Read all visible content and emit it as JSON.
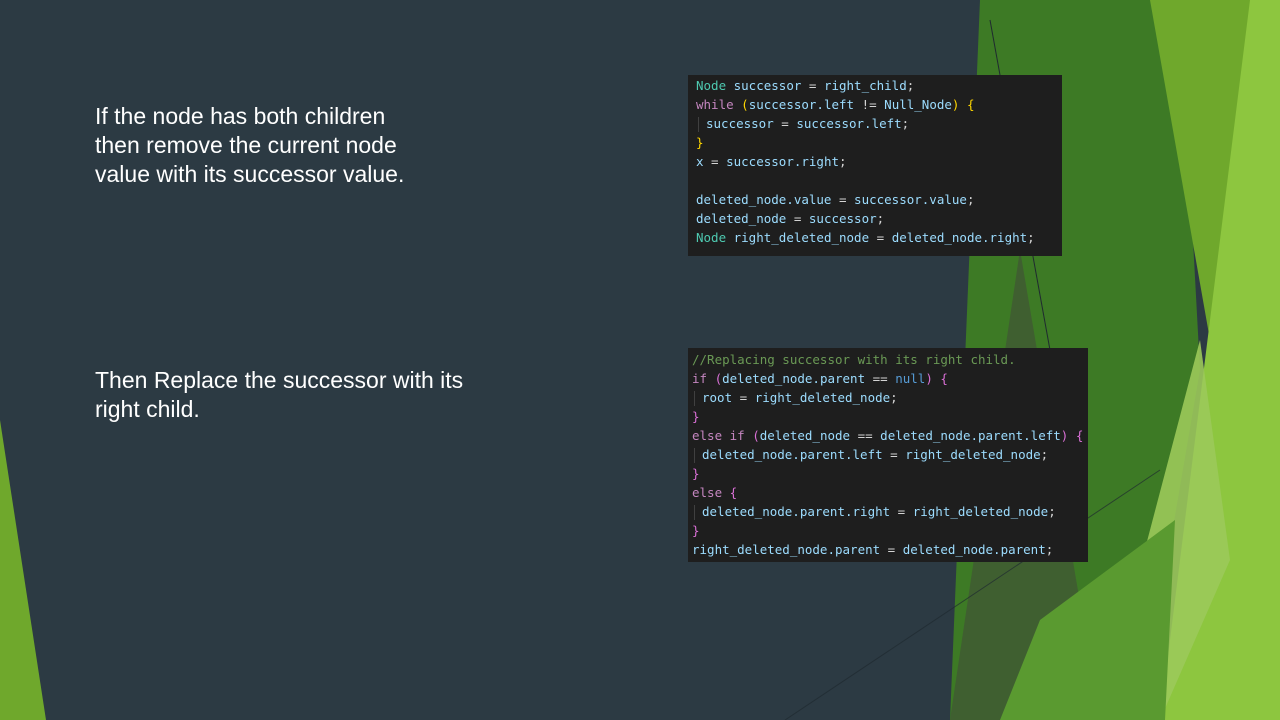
{
  "slide": {
    "colors": {
      "background": "#2c3a43",
      "accent_green_light": "#8dc63f",
      "accent_green_mid": "#6fa82c",
      "accent_green_dark": "#3d7a25"
    },
    "text_blocks": [
      {
        "lines": [
          "If the node has both children",
          "then remove the current node",
          "value with its successor value."
        ]
      },
      {
        "lines": [
          "Then Replace the successor with its",
          "right child."
        ]
      }
    ]
  },
  "code_panels": [
    {
      "lines": [
        [
          [
            "type",
            "Node"
          ],
          [
            "var",
            " successor"
          ],
          [
            "op",
            " = "
          ],
          [
            "var",
            "right_child"
          ],
          [
            "op",
            ";"
          ]
        ],
        [
          [
            "kw",
            "while"
          ],
          [
            "op",
            " "
          ],
          [
            "bracket",
            "("
          ],
          [
            "var",
            "successor.left"
          ],
          [
            "op",
            " != "
          ],
          [
            "var",
            "Null_Node"
          ],
          [
            "bracket",
            ")"
          ],
          [
            "op",
            " "
          ],
          [
            "bracket",
            "{"
          ]
        ],
        [
          [
            "guide",
            ""
          ],
          [
            "var",
            "successor"
          ],
          [
            "op",
            " = "
          ],
          [
            "var",
            "successor.left"
          ],
          [
            "op",
            ";"
          ]
        ],
        [
          [
            "bracket",
            "}"
          ]
        ],
        [
          [
            "var",
            "x"
          ],
          [
            "op",
            " = "
          ],
          [
            "var",
            "successor.right"
          ],
          [
            "op",
            ";"
          ]
        ],
        [],
        [
          [
            "var",
            "deleted_node.value"
          ],
          [
            "op",
            " = "
          ],
          [
            "var",
            "successor.value"
          ],
          [
            "op",
            ";"
          ]
        ],
        [
          [
            "var",
            "deleted_node"
          ],
          [
            "op",
            " = "
          ],
          [
            "var",
            "successor"
          ],
          [
            "op",
            ";"
          ]
        ],
        [
          [
            "type",
            "Node"
          ],
          [
            "var",
            " right_deleted_node"
          ],
          [
            "op",
            " = "
          ],
          [
            "var",
            "deleted_node.right"
          ],
          [
            "op",
            ";"
          ]
        ]
      ]
    },
    {
      "lines": [
        [
          [
            "comment",
            "//Replacing successor with its right child."
          ]
        ],
        [
          [
            "kw",
            "if"
          ],
          [
            "op",
            " "
          ],
          [
            "brace2",
            "("
          ],
          [
            "var",
            "deleted_node.parent"
          ],
          [
            "op",
            " == "
          ],
          [
            "const",
            "null"
          ],
          [
            "brace2",
            ")"
          ],
          [
            "op",
            " "
          ],
          [
            "brace2",
            "{"
          ]
        ],
        [
          [
            "guide",
            ""
          ],
          [
            "var",
            "root"
          ],
          [
            "op",
            " = "
          ],
          [
            "var",
            "right_deleted_node"
          ],
          [
            "op",
            ";"
          ]
        ],
        [
          [
            "brace2",
            "}"
          ]
        ],
        [
          [
            "kw",
            "else if"
          ],
          [
            "op",
            " "
          ],
          [
            "brace2",
            "("
          ],
          [
            "var",
            "deleted_node"
          ],
          [
            "op",
            " == "
          ],
          [
            "var",
            "deleted_node.parent.left"
          ],
          [
            "brace2",
            ")"
          ],
          [
            "op",
            " "
          ],
          [
            "brace2",
            "{"
          ]
        ],
        [
          [
            "guide",
            ""
          ],
          [
            "var",
            "deleted_node.parent.left"
          ],
          [
            "op",
            " = "
          ],
          [
            "var",
            "right_deleted_node"
          ],
          [
            "op",
            ";"
          ]
        ],
        [
          [
            "brace2",
            "}"
          ]
        ],
        [
          [
            "kw",
            "else"
          ],
          [
            "op",
            " "
          ],
          [
            "brace2",
            "{"
          ]
        ],
        [
          [
            "guide",
            ""
          ],
          [
            "var",
            "deleted_node.parent.right"
          ],
          [
            "op",
            " = "
          ],
          [
            "var",
            "right_deleted_node"
          ],
          [
            "op",
            ";"
          ]
        ],
        [
          [
            "brace2",
            "}"
          ]
        ],
        [
          [
            "var",
            "right_deleted_node.parent"
          ],
          [
            "op",
            " = "
          ],
          [
            "var",
            "deleted_node.parent"
          ],
          [
            "op",
            ";"
          ]
        ]
      ]
    }
  ]
}
